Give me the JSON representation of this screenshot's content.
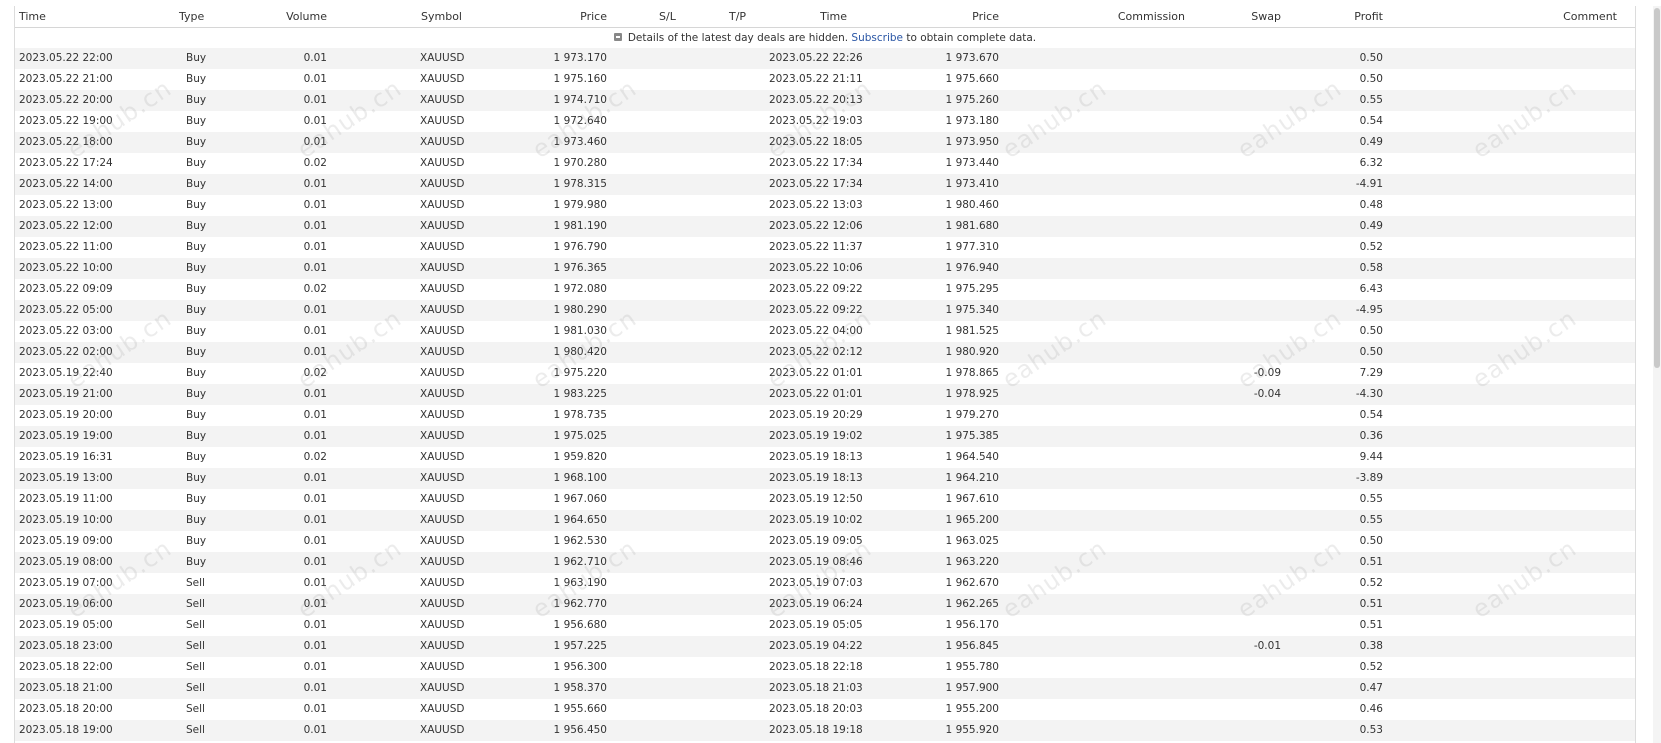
{
  "headers": {
    "time_open": "Time",
    "type": "Type",
    "volume": "Volume",
    "symbol": "Symbol",
    "price_open": "Price",
    "sl": "S/L",
    "tp": "T/P",
    "time_close": "Time",
    "price_close": "Price",
    "commission": "Commission",
    "swap": "Swap",
    "profit": "Profit",
    "comment": "Comment"
  },
  "notice": {
    "before": "Details of the latest day deals are hidden.",
    "link": "Subscribe",
    "after": "to obtain complete data."
  },
  "watermark_text": "eahub.cn",
  "colors": {
    "positive": "#2a56a5",
    "negative": "#c00000",
    "stripe": "#f3f3f3"
  },
  "rows": [
    {
      "t1": "2023.05.22 22:00",
      "type": "Buy",
      "vol": "0.01",
      "sym": "XAUUSD",
      "p1": "1 973.170",
      "t2": "2023.05.22 22:26",
      "p2": "1 973.670",
      "swap": "",
      "profit": "0.50"
    },
    {
      "t1": "2023.05.22 21:00",
      "type": "Buy",
      "vol": "0.01",
      "sym": "XAUUSD",
      "p1": "1 975.160",
      "t2": "2023.05.22 21:11",
      "p2": "1 975.660",
      "swap": "",
      "profit": "0.50"
    },
    {
      "t1": "2023.05.22 20:00",
      "type": "Buy",
      "vol": "0.01",
      "sym": "XAUUSD",
      "p1": "1 974.710",
      "t2": "2023.05.22 20:13",
      "p2": "1 975.260",
      "swap": "",
      "profit": "0.55"
    },
    {
      "t1": "2023.05.22 19:00",
      "type": "Buy",
      "vol": "0.01",
      "sym": "XAUUSD",
      "p1": "1 972.640",
      "t2": "2023.05.22 19:03",
      "p2": "1 973.180",
      "swap": "",
      "profit": "0.54"
    },
    {
      "t1": "2023.05.22 18:00",
      "type": "Buy",
      "vol": "0.01",
      "sym": "XAUUSD",
      "p1": "1 973.460",
      "t2": "2023.05.22 18:05",
      "p2": "1 973.950",
      "swap": "",
      "profit": "0.49"
    },
    {
      "t1": "2023.05.22 17:24",
      "type": "Buy",
      "vol": "0.02",
      "sym": "XAUUSD",
      "p1": "1 970.280",
      "t2": "2023.05.22 17:34",
      "p2": "1 973.440",
      "swap": "",
      "profit": "6.32"
    },
    {
      "t1": "2023.05.22 14:00",
      "type": "Buy",
      "vol": "0.01",
      "sym": "XAUUSD",
      "p1": "1 978.315",
      "t2": "2023.05.22 17:34",
      "p2": "1 973.410",
      "swap": "",
      "profit": "-4.91"
    },
    {
      "t1": "2023.05.22 13:00",
      "type": "Buy",
      "vol": "0.01",
      "sym": "XAUUSD",
      "p1": "1 979.980",
      "t2": "2023.05.22 13:03",
      "p2": "1 980.460",
      "swap": "",
      "profit": "0.48"
    },
    {
      "t1": "2023.05.22 12:00",
      "type": "Buy",
      "vol": "0.01",
      "sym": "XAUUSD",
      "p1": "1 981.190",
      "t2": "2023.05.22 12:06",
      "p2": "1 981.680",
      "swap": "",
      "profit": "0.49"
    },
    {
      "t1": "2023.05.22 11:00",
      "type": "Buy",
      "vol": "0.01",
      "sym": "XAUUSD",
      "p1": "1 976.790",
      "t2": "2023.05.22 11:37",
      "p2": "1 977.310",
      "swap": "",
      "profit": "0.52"
    },
    {
      "t1": "2023.05.22 10:00",
      "type": "Buy",
      "vol": "0.01",
      "sym": "XAUUSD",
      "p1": "1 976.365",
      "t2": "2023.05.22 10:06",
      "p2": "1 976.940",
      "swap": "",
      "profit": "0.58"
    },
    {
      "t1": "2023.05.22 09:09",
      "type": "Buy",
      "vol": "0.02",
      "sym": "XAUUSD",
      "p1": "1 972.080",
      "t2": "2023.05.22 09:22",
      "p2": "1 975.295",
      "swap": "",
      "profit": "6.43"
    },
    {
      "t1": "2023.05.22 05:00",
      "type": "Buy",
      "vol": "0.01",
      "sym": "XAUUSD",
      "p1": "1 980.290",
      "t2": "2023.05.22 09:22",
      "p2": "1 975.340",
      "swap": "",
      "profit": "-4.95"
    },
    {
      "t1": "2023.05.22 03:00",
      "type": "Buy",
      "vol": "0.01",
      "sym": "XAUUSD",
      "p1": "1 981.030",
      "t2": "2023.05.22 04:00",
      "p2": "1 981.525",
      "swap": "",
      "profit": "0.50"
    },
    {
      "t1": "2023.05.22 02:00",
      "type": "Buy",
      "vol": "0.01",
      "sym": "XAUUSD",
      "p1": "1 980.420",
      "t2": "2023.05.22 02:12",
      "p2": "1 980.920",
      "swap": "",
      "profit": "0.50"
    },
    {
      "t1": "2023.05.19 22:40",
      "type": "Buy",
      "vol": "0.02",
      "sym": "XAUUSD",
      "p1": "1 975.220",
      "t2": "2023.05.22 01:01",
      "p2": "1 978.865",
      "swap": "-0.09",
      "profit": "7.29"
    },
    {
      "t1": "2023.05.19 21:00",
      "type": "Buy",
      "vol": "0.01",
      "sym": "XAUUSD",
      "p1": "1 983.225",
      "t2": "2023.05.22 01:01",
      "p2": "1 978.925",
      "swap": "-0.04",
      "profit": "-4.30"
    },
    {
      "t1": "2023.05.19 20:00",
      "type": "Buy",
      "vol": "0.01",
      "sym": "XAUUSD",
      "p1": "1 978.735",
      "t2": "2023.05.19 20:29",
      "p2": "1 979.270",
      "swap": "",
      "profit": "0.54"
    },
    {
      "t1": "2023.05.19 19:00",
      "type": "Buy",
      "vol": "0.01",
      "sym": "XAUUSD",
      "p1": "1 975.025",
      "t2": "2023.05.19 19:02",
      "p2": "1 975.385",
      "swap": "",
      "profit": "0.36"
    },
    {
      "t1": "2023.05.19 16:31",
      "type": "Buy",
      "vol": "0.02",
      "sym": "XAUUSD",
      "p1": "1 959.820",
      "t2": "2023.05.19 18:13",
      "p2": "1 964.540",
      "swap": "",
      "profit": "9.44"
    },
    {
      "t1": "2023.05.19 13:00",
      "type": "Buy",
      "vol": "0.01",
      "sym": "XAUUSD",
      "p1": "1 968.100",
      "t2": "2023.05.19 18:13",
      "p2": "1 964.210",
      "swap": "",
      "profit": "-3.89"
    },
    {
      "t1": "2023.05.19 11:00",
      "type": "Buy",
      "vol": "0.01",
      "sym": "XAUUSD",
      "p1": "1 967.060",
      "t2": "2023.05.19 12:50",
      "p2": "1 967.610",
      "swap": "",
      "profit": "0.55"
    },
    {
      "t1": "2023.05.19 10:00",
      "type": "Buy",
      "vol": "0.01",
      "sym": "XAUUSD",
      "p1": "1 964.650",
      "t2": "2023.05.19 10:02",
      "p2": "1 965.200",
      "swap": "",
      "profit": "0.55"
    },
    {
      "t1": "2023.05.19 09:00",
      "type": "Buy",
      "vol": "0.01",
      "sym": "XAUUSD",
      "p1": "1 962.530",
      "t2": "2023.05.19 09:05",
      "p2": "1 963.025",
      "swap": "",
      "profit": "0.50"
    },
    {
      "t1": "2023.05.19 08:00",
      "type": "Buy",
      "vol": "0.01",
      "sym": "XAUUSD",
      "p1": "1 962.710",
      "t2": "2023.05.19 08:46",
      "p2": "1 963.220",
      "swap": "",
      "profit": "0.51"
    },
    {
      "t1": "2023.05.19 07:00",
      "type": "Sell",
      "vol": "0.01",
      "sym": "XAUUSD",
      "p1": "1 963.190",
      "t2": "2023.05.19 07:03",
      "p2": "1 962.670",
      "swap": "",
      "profit": "0.52"
    },
    {
      "t1": "2023.05.19 06:00",
      "type": "Sell",
      "vol": "0.01",
      "sym": "XAUUSD",
      "p1": "1 962.770",
      "t2": "2023.05.19 06:24",
      "p2": "1 962.265",
      "swap": "",
      "profit": "0.51"
    },
    {
      "t1": "2023.05.19 05:00",
      "type": "Sell",
      "vol": "0.01",
      "sym": "XAUUSD",
      "p1": "1 956.680",
      "t2": "2023.05.19 05:05",
      "p2": "1 956.170",
      "swap": "",
      "profit": "0.51"
    },
    {
      "t1": "2023.05.18 23:00",
      "type": "Sell",
      "vol": "0.01",
      "sym": "XAUUSD",
      "p1": "1 957.225",
      "t2": "2023.05.19 04:22",
      "p2": "1 956.845",
      "swap": "-0.01",
      "profit": "0.38"
    },
    {
      "t1": "2023.05.18 22:00",
      "type": "Sell",
      "vol": "0.01",
      "sym": "XAUUSD",
      "p1": "1 956.300",
      "t2": "2023.05.18 22:18",
      "p2": "1 955.780",
      "swap": "",
      "profit": "0.52"
    },
    {
      "t1": "2023.05.18 21:00",
      "type": "Sell",
      "vol": "0.01",
      "sym": "XAUUSD",
      "p1": "1 958.370",
      "t2": "2023.05.18 21:03",
      "p2": "1 957.900",
      "swap": "",
      "profit": "0.47"
    },
    {
      "t1": "2023.05.18 20:00",
      "type": "Sell",
      "vol": "0.01",
      "sym": "XAUUSD",
      "p1": "1 955.660",
      "t2": "2023.05.18 20:03",
      "p2": "1 955.200",
      "swap": "",
      "profit": "0.46"
    },
    {
      "t1": "2023.05.18 19:00",
      "type": "Sell",
      "vol": "0.01",
      "sym": "XAUUSD",
      "p1": "1 956.450",
      "t2": "2023.05.18 19:18",
      "p2": "1 955.920",
      "swap": "",
      "profit": "0.53"
    }
  ]
}
